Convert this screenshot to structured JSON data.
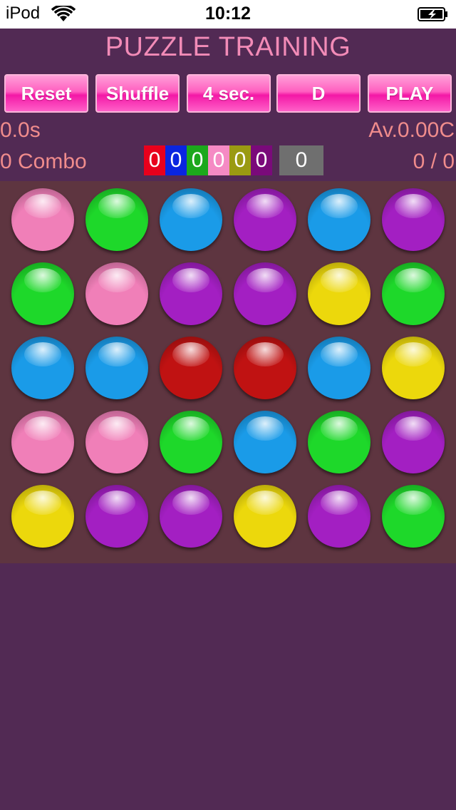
{
  "status_bar": {
    "carrier": "iPod",
    "time": "10:12"
  },
  "title": "PUZZLE TRAINING",
  "buttons": [
    {
      "label": "Reset"
    },
    {
      "label": "Shuffle"
    },
    {
      "label": "4 sec."
    },
    {
      "label": "D"
    },
    {
      "label": "PLAY"
    }
  ],
  "info": {
    "time": "0.0s",
    "average": "Av.0.00C",
    "combo": "0 Combo",
    "progress": "0 / 0",
    "total": "0"
  },
  "color_counts": [
    {
      "value": "0",
      "color": "#e8001c"
    },
    {
      "value": "0",
      "color": "#0a25e0"
    },
    {
      "value": "0",
      "color": "#1ca81c"
    },
    {
      "value": "0",
      "color": "#f58ac4"
    },
    {
      "value": "0",
      "color": "#9a9a12"
    },
    {
      "value": "0",
      "color": "#7a0a7a"
    }
  ],
  "orb_colors": {
    "pink": "#f07fb8",
    "green": "#1ed82a",
    "blue": "#1a9be8",
    "purple": "#a31fc2",
    "yellow": "#ecd80c",
    "red": "#c01212"
  },
  "board": [
    [
      "pink",
      "green",
      "blue",
      "purple",
      "blue",
      "purple"
    ],
    [
      "green",
      "pink",
      "purple",
      "purple",
      "yellow",
      "green"
    ],
    [
      "blue",
      "blue",
      "red",
      "red",
      "blue",
      "yellow"
    ],
    [
      "pink",
      "pink",
      "green",
      "blue",
      "green",
      "purple"
    ],
    [
      "yellow",
      "purple",
      "purple",
      "yellow",
      "purple",
      "green"
    ]
  ]
}
